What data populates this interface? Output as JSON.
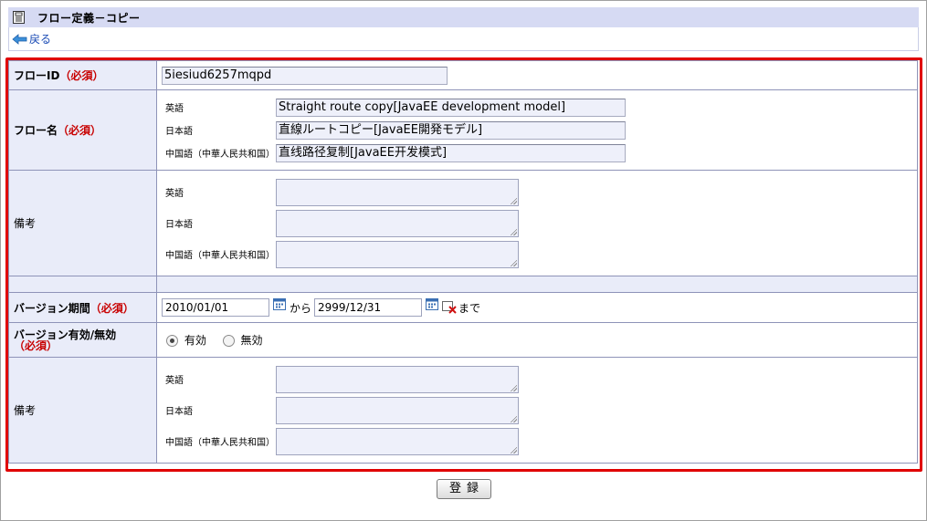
{
  "header": {
    "title": "フロー定義－コピー"
  },
  "nav": {
    "back_label": "戻る"
  },
  "form": {
    "required_label": "（必須）",
    "flow_id": {
      "label": "フローID",
      "value": "5iesiud6257mqpd"
    },
    "flow_name": {
      "label": "フロー名",
      "langs": [
        {
          "lang": "英語",
          "value": "Straight route copy[JavaEE development model]"
        },
        {
          "lang": "日本語",
          "value": "直線ルートコピー[JavaEE開発モデル]"
        },
        {
          "lang": "中国語（中華人民共和国）",
          "value": "直线路径复制[JavaEE开发模式]"
        }
      ]
    },
    "remarks1": {
      "label": "備考",
      "langs": [
        {
          "lang": "英語",
          "value": ""
        },
        {
          "lang": "日本語",
          "value": ""
        },
        {
          "lang": "中国語（中華人民共和国）",
          "value": ""
        }
      ]
    },
    "version_period": {
      "label": "バージョン期間",
      "from": "2010/01/01",
      "from_text": "から",
      "to": "2999/12/31",
      "to_text": "まで"
    },
    "version_enabled": {
      "label": "バージョン有効/無効",
      "options": [
        "有効",
        "無効"
      ],
      "selected": "有効"
    },
    "remarks2": {
      "label": "備考",
      "langs": [
        {
          "lang": "英語",
          "value": ""
        },
        {
          "lang": "日本語",
          "value": ""
        },
        {
          "lang": "中国語（中華人民共和国）",
          "value": ""
        }
      ]
    }
  },
  "actions": {
    "register_label": "登録"
  },
  "colors": {
    "highlight_border": "#e00000",
    "label_bg": "#e9ecf9",
    "title_bg": "#d6daf3",
    "required_text": "#c80000"
  }
}
